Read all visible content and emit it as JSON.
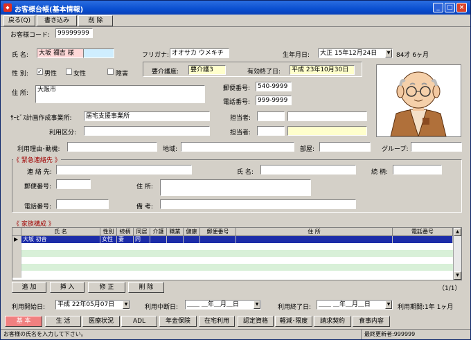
{
  "window": {
    "title": "お客様台帳(基本情報)",
    "app_icon": "app-icon",
    "min": "_",
    "max": "□",
    "close": "×"
  },
  "toolbar": {
    "back": "戻る(Q)",
    "save": "書き込み",
    "delete": "削 除"
  },
  "customer_code": {
    "label": "お客様コード:",
    "value": "99999999"
  },
  "name": {
    "label": "氏 名:",
    "value": "大坂 禰吉 様"
  },
  "furigana": {
    "label": "フリガナ:",
    "value": "オオサカ ウメキチ"
  },
  "birthdate": {
    "label": "生年月日:",
    "value": "大正 15年12月24日",
    "age": "84才 6ヶ月"
  },
  "gender": {
    "label": "性 別:",
    "male": "男性",
    "female": "女性",
    "disabled": "障害",
    "male_checked": "✓"
  },
  "care_level": {
    "label": "要介護度:",
    "value": "要介護3"
  },
  "valid_until": {
    "label": "有効終了日:",
    "value": "平成 23年10月30日"
  },
  "address": {
    "label": "住 所:",
    "value": "大阪市"
  },
  "postal": {
    "label": "郵便番号:",
    "value": "540-9999"
  },
  "phone": {
    "label": "電話番号:",
    "value": "999-9999"
  },
  "care_plan": {
    "label": "ｻｰﾋﾞｽ計画作成事業所:",
    "value": "居宅支援事業所"
  },
  "staff1": {
    "label": "担当者:"
  },
  "staff2": {
    "label": "担当者:"
  },
  "usage_class": {
    "label": "利用区分:"
  },
  "reason": {
    "label": "利用理由･動機:"
  },
  "region": {
    "label": "地域:"
  },
  "room": {
    "label": "部屋:"
  },
  "group": {
    "label": "グループ:"
  },
  "emergency": {
    "title": "《 緊急連絡先 》",
    "contact_label": "連 絡 先:",
    "name_label": "氏 名:",
    "relation_label": "続 柄:",
    "postal_label": "郵便番号:",
    "address_label": "住 所:",
    "phone_label": "電話番号:",
    "note_label": "備 考:"
  },
  "family": {
    "title": "《 家族構成 》",
    "columns": [
      "氏 名",
      "性別",
      "続柄",
      "同居",
      "介護",
      "職業",
      "健康",
      "郵便番号",
      "住 所",
      "電話番号"
    ],
    "rows": [
      [
        "大坂 初音",
        "女性",
        "妻",
        "同",
        "",
        "",
        "",
        "",
        "",
        ""
      ]
    ],
    "page": "（1/1）"
  },
  "family_buttons": {
    "add": "追 加",
    "insert": "挿 入",
    "edit": "修 正",
    "delete": "削 除"
  },
  "start_date": {
    "label": "利用開始日:",
    "value": "平成 22年05月07日"
  },
  "suspend_date": {
    "label": "利用中断日:",
    "value": "＿＿ ＿年＿月＿日"
  },
  "end_date": {
    "label": "利用終了日:",
    "value": "＿＿ ＿年＿月＿日"
  },
  "period": {
    "label": "利用期間:1年 1ヶ月"
  },
  "tabs": [
    "基 本",
    "生 活",
    "医療状況",
    "ADL",
    "年金保険",
    "在宅利用",
    "認定資格",
    "軽減･限度",
    "請求契約",
    "食事内容"
  ],
  "status": {
    "message": "お客様の氏名を入力して下さい。",
    "updater": "最終更新者:999999"
  }
}
